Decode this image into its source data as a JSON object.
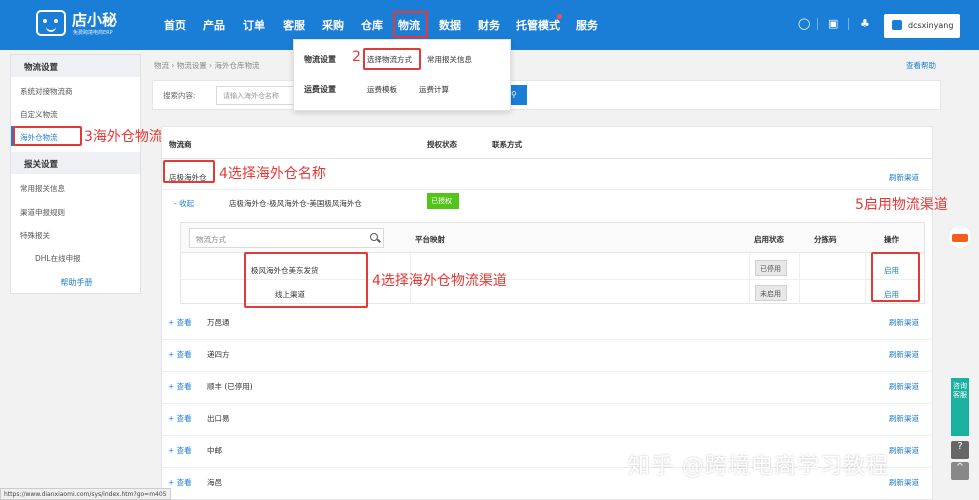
{
  "logo": {
    "title": "店小秘",
    "subtitle": "免费跨境电商ERP"
  },
  "nav": {
    "items": [
      "首页",
      "产品",
      "订单",
      "客服",
      "采购",
      "仓库",
      "物流",
      "数据",
      "财务",
      "托管模式",
      "服务"
    ],
    "username": "dcsxinyang"
  },
  "dropdown": {
    "group1": "物流设置",
    "group1_items": [
      "选择物流方式",
      "常用报关信息"
    ],
    "group2": "运费设置",
    "group2_items": [
      "运费模板",
      "运费计算"
    ]
  },
  "sidebar": {
    "section1": "物流设置",
    "items1": [
      "系统对接物流商",
      "自定义物流",
      "海外仓物流"
    ],
    "section2": "报关设置",
    "items2": [
      "常用报关信息",
      "渠道申报规则",
      "特殊报关",
      "DHL在线申报"
    ],
    "help": "帮助手册"
  },
  "breadcrumb": "物流 › 物流设置 › 海外仓库物流",
  "help_link": "查看帮助",
  "search": {
    "label": "搜索内容:",
    "placeholder": "请输入海外仓名称"
  },
  "table": {
    "headers": [
      "物流商",
      "授权状态",
      "联系方式"
    ],
    "warehouse": {
      "name": "店极海外仓",
      "collapse": "- 收起",
      "full_name": "店极海外仓-极风海外仓-美国极风海外仓",
      "auth_status": "已授权",
      "refresh": "刷新渠道"
    },
    "inner": {
      "search_placeholder": "物流方式",
      "headers": [
        "平台映射",
        "启用状态",
        "分拣码",
        "操作"
      ],
      "rows": [
        {
          "name": "极风海外仓美东发货",
          "status": "已停用",
          "action": "启用"
        },
        {
          "name": "线上渠道",
          "status": "未启用",
          "action": "启用"
        }
      ]
    },
    "others": [
      {
        "link": "+ 查看",
        "name": "万邑通",
        "refresh": "刷新渠道"
      },
      {
        "link": "+ 查看",
        "name": "递四方",
        "refresh": "刷新渠道"
      },
      {
        "link": "+ 查看",
        "name": "顺丰 (已停用)",
        "refresh": "刷新渠道"
      },
      {
        "link": "+ 查看",
        "name": "出口易",
        "refresh": "刷新渠道"
      },
      {
        "link": "+ 查看",
        "name": "中邮",
        "refresh": "刷新渠道"
      },
      {
        "link": "+ 查看",
        "name": "海邑",
        "refresh": "刷新渠道"
      }
    ]
  },
  "annotations": {
    "a2": "2",
    "a3": "3海外仓物流",
    "a4a": "4选择海外仓名称",
    "a4b": "4选择海外仓物流渠道",
    "a5": "5启用物流渠道"
  },
  "float": {
    "cs": "咨询客服",
    "q": "?",
    "top": "^"
  },
  "watermark": "知乎 @跨境电商学习教程",
  "status_url": "https://www.dianxiaomi.com/sys/index.htm?go=m405",
  "colors": {
    "primary": "#1a7ed6",
    "annotation": "#e53935",
    "authorized": "#52c41a"
  }
}
